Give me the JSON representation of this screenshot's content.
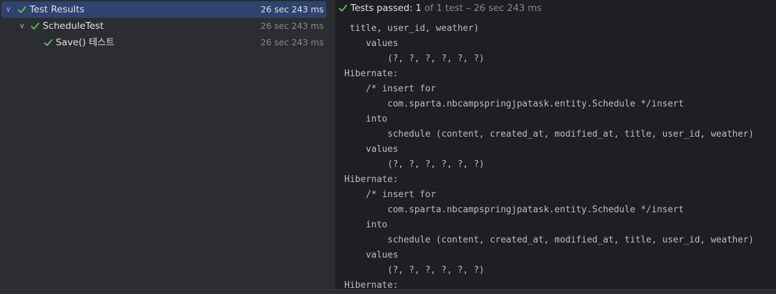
{
  "tree": {
    "rows": [
      {
        "label": "Test Results",
        "time": "26 sec 243 ms",
        "selected": true
      },
      {
        "label": "ScheduleTest",
        "time": "26 sec 243 ms"
      },
      {
        "label": "Save() 테스트",
        "time": "26 sec 243 ms"
      }
    ]
  },
  "header": {
    "status_prefix": "Tests passed:",
    "passed_count": "1",
    "of_text": "of 1 test",
    "separator": "–",
    "duration": "26 sec 243 ms"
  },
  "console": {
    "lines": [
      " title, user_id, weather)",
      "    values",
      "        (?, ?, ?, ?, ?, ?)",
      "Hibernate: ",
      "    /* insert for",
      "        com.sparta.nbcampspringjpatask.entity.Schedule */insert",
      "    into",
      "        schedule (content, created_at, modified_at, title, user_id, weather)",
      "    values",
      "        (?, ?, ?, ?, ?, ?)",
      "Hibernate: ",
      "    /* insert for",
      "        com.sparta.nbcampspringjpatask.entity.Schedule */insert",
      "    into",
      "        schedule (content, created_at, modified_at, title, user_id, weather)",
      "    values",
      "        (?, ?, ?, ?, ?, ?)",
      "Hibernate: "
    ]
  },
  "colors": {
    "pass_green": "#5fb865",
    "selection": "#2e436e",
    "console_bg": "#1e1f22",
    "panel_bg": "#2b2d30"
  }
}
